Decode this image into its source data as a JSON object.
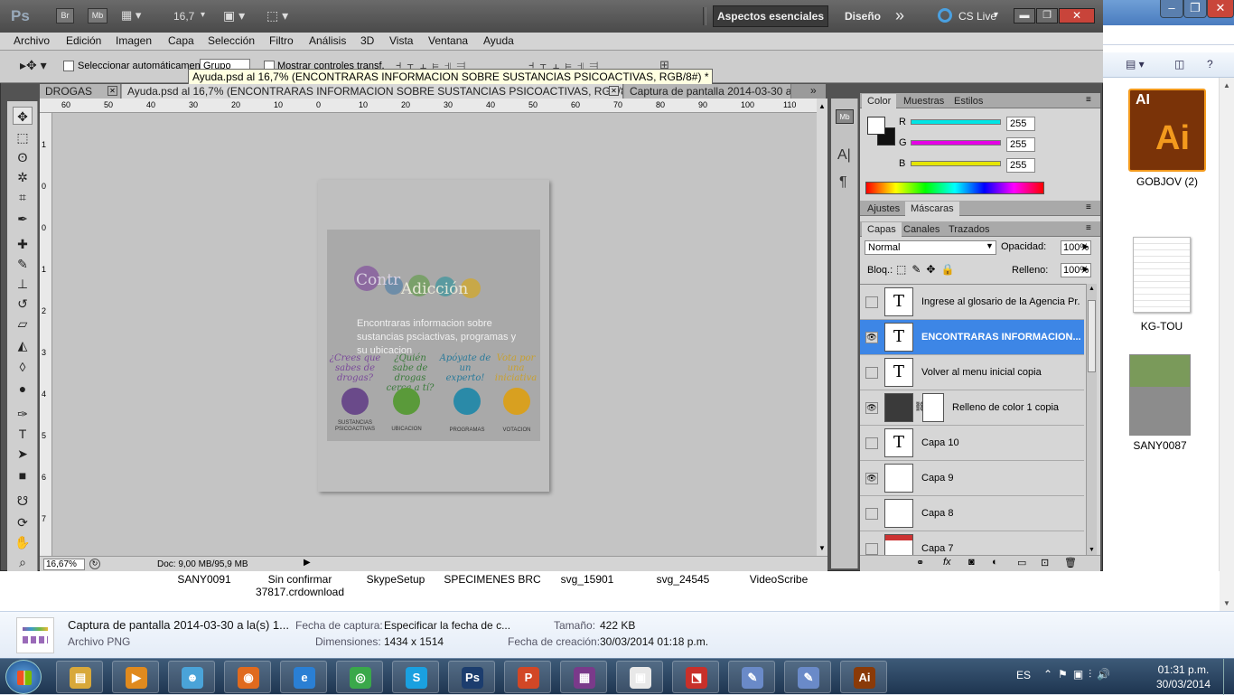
{
  "explorer": {
    "desktop_icons": [
      {
        "name": "GOBJOV (2)",
        "icon": "illustrator-file-icon"
      },
      {
        "name": "KG-TOU",
        "icon": "document-file-icon"
      },
      {
        "name": "SANY0087",
        "icon": "photo-thumbnail-icon"
      }
    ],
    "files": [
      {
        "name": "SANY0091"
      },
      {
        "name": "Sin confirmar 37817.crdownload"
      },
      {
        "name": "SkypeSetup"
      },
      {
        "name": "SPECIMENES BRC"
      },
      {
        "name": "svg_15901"
      },
      {
        "name": "svg_24545"
      },
      {
        "name": "VideoScribe"
      }
    ],
    "details": {
      "filename": "Captura de pantalla 2014-03-30 a la(s) 1...",
      "filetype": "Archivo PNG",
      "capture_label": "Fecha de captura:",
      "capture_value": "Especificar la fecha de c...",
      "size_label": "Tamaño:",
      "size_value": "422 KB",
      "dims_label": "Dimensiones:",
      "dims_value": "1434 x 1514",
      "created_label": "Fecha de creación:",
      "created_value": "30/03/2014 01:18 p.m."
    }
  },
  "ps": {
    "logo": "Ps",
    "app_buttons": [
      "Br",
      "Mb"
    ],
    "zoom_select": "16,7",
    "workspace_active": "Aspectos esenciales",
    "workspace_other": "Diseño",
    "workspace_more": "»",
    "cs_live": "CS Live",
    "menu": [
      "Archivo",
      "Edición",
      "Imagen",
      "Capa",
      "Selección",
      "Filtro",
      "Análisis",
      "3D",
      "Vista",
      "Ventana",
      "Ayuda"
    ],
    "options": {
      "auto_select_label": "Seleccionar automáticamente:",
      "auto_select_value": "Grupo",
      "show_controls_label": "Mostrar controles transf."
    },
    "tooltip": "Ayuda.psd al 16,7% (ENCONTRARAS INFORMACION SOBRE SUSTANCIAS PSICOACTIVAS, RGB/8#) *",
    "tabs": [
      {
        "label": "DROGAS"
      },
      {
        "label": "Ayuda.psd al 16,7% (ENCONTRARAS INFORMACION SOBRE SUSTANCIAS PSICOACTIVAS, RGB/8#) *"
      },
      {
        "label": "Captura de pantalla 2014-03-30 a"
      }
    ],
    "ruler_top": [
      "60",
      "50",
      "40",
      "30",
      "20",
      "10",
      "0",
      "10",
      "20",
      "30",
      "40",
      "50",
      "60",
      "70",
      "80",
      "90",
      "100",
      "110"
    ],
    "ruler_left": [
      "1",
      "0",
      "0",
      "1",
      "2",
      "3",
      "4",
      "5",
      "6",
      "7",
      "8"
    ],
    "status": {
      "zoom": "16,67%",
      "doc": "Doc: 9,00 MB/95,9 MB"
    },
    "artwork": {
      "logo_text_a": "Contr",
      "logo_text_b": "Adicción",
      "headline": "Encontraras informacion sobre sustancias psciactivas, programas y su ubicacion",
      "questions": [
        "¿Crees que sabes de drogas?",
        "¿Quién sabe de drogas cerca a tí?",
        "Apóyate de un experto!",
        "Vota por una iniciativa"
      ],
      "captions": [
        "SUSTANCIAS PSICOACTIVAS",
        "UBICACION",
        "PROGRAMAS",
        "VOTACION"
      ]
    },
    "color_panel": {
      "tabs": [
        "Color",
        "Muestras",
        "Estilos"
      ],
      "channels": [
        {
          "label": "R",
          "value": "255",
          "color": "#00e5e5"
        },
        {
          "label": "G",
          "value": "255",
          "color": "#e500e5"
        },
        {
          "label": "B",
          "value": "255",
          "color": "#e5e500"
        }
      ]
    },
    "adjust_panel": {
      "tabs": [
        "Ajustes",
        "Máscaras"
      ]
    },
    "layers_panel": {
      "tabs": [
        "Capas",
        "Canales",
        "Trazados"
      ],
      "blend_mode": "Normal",
      "opacity_label": "Opacidad:",
      "opacity_value": "100%",
      "lock_label": "Bloq.:",
      "fill_label": "Relleno:",
      "fill_value": "100%",
      "layers": [
        {
          "name": "Ingrese al glosario de la Agencia Pr...",
          "visible": false,
          "kind": "text",
          "selected": false
        },
        {
          "name": "ENCONTRARAS INFORMACION...",
          "visible": true,
          "kind": "text",
          "selected": true
        },
        {
          "name": "Volver al menu inicial copia",
          "visible": false,
          "kind": "text",
          "selected": false
        },
        {
          "name": "Relleno de color 1 copia",
          "visible": true,
          "kind": "fill",
          "selected": false
        },
        {
          "name": "Capa 10",
          "visible": false,
          "kind": "text",
          "selected": false
        },
        {
          "name": "Capa 9",
          "visible": true,
          "kind": "image",
          "selected": false
        },
        {
          "name": "Capa 8",
          "visible": false,
          "kind": "image",
          "selected": false
        },
        {
          "name": "Capa 7",
          "visible": false,
          "kind": "image",
          "selected": false
        }
      ]
    }
  },
  "taskbar": {
    "apps": [
      {
        "name": "file-explorer-icon",
        "glyph": "▤",
        "color": "#d8a83a"
      },
      {
        "name": "media-player-icon",
        "glyph": "▶",
        "color": "#e08a1e"
      },
      {
        "name": "network-people-icon",
        "glyph": "☻",
        "color": "#4aa3d8"
      },
      {
        "name": "firefox-icon",
        "glyph": "◉",
        "color": "#e06a1e"
      },
      {
        "name": "internet-explorer-icon",
        "glyph": "e",
        "color": "#2a7fd4"
      },
      {
        "name": "chrome-icon",
        "glyph": "◎",
        "color": "#3aa84a"
      },
      {
        "name": "skype-icon",
        "glyph": "S",
        "color": "#1aa0e0"
      },
      {
        "name": "photoshop-icon",
        "glyph": "Ps",
        "color": "#1c3d6e"
      },
      {
        "name": "powerpoint-icon",
        "glyph": "P",
        "color": "#d24726"
      },
      {
        "name": "winrar-icon",
        "glyph": "▦",
        "color": "#7a3a8a"
      },
      {
        "name": "document-viewer-icon",
        "glyph": "▣",
        "color": "#e8e8e8"
      },
      {
        "name": "pdf-icon",
        "glyph": "⬔",
        "color": "#c8302a"
      },
      {
        "name": "paint-icon",
        "glyph": "✎",
        "color": "#6a8ac8"
      },
      {
        "name": "paint-2-icon",
        "glyph": "✎",
        "color": "#6a8ac8"
      },
      {
        "name": "illustrator-icon",
        "glyph": "Ai",
        "color": "#8a3a08"
      }
    ],
    "lang": "ES",
    "time": "01:31 p.m.",
    "date": "30/03/2014"
  }
}
